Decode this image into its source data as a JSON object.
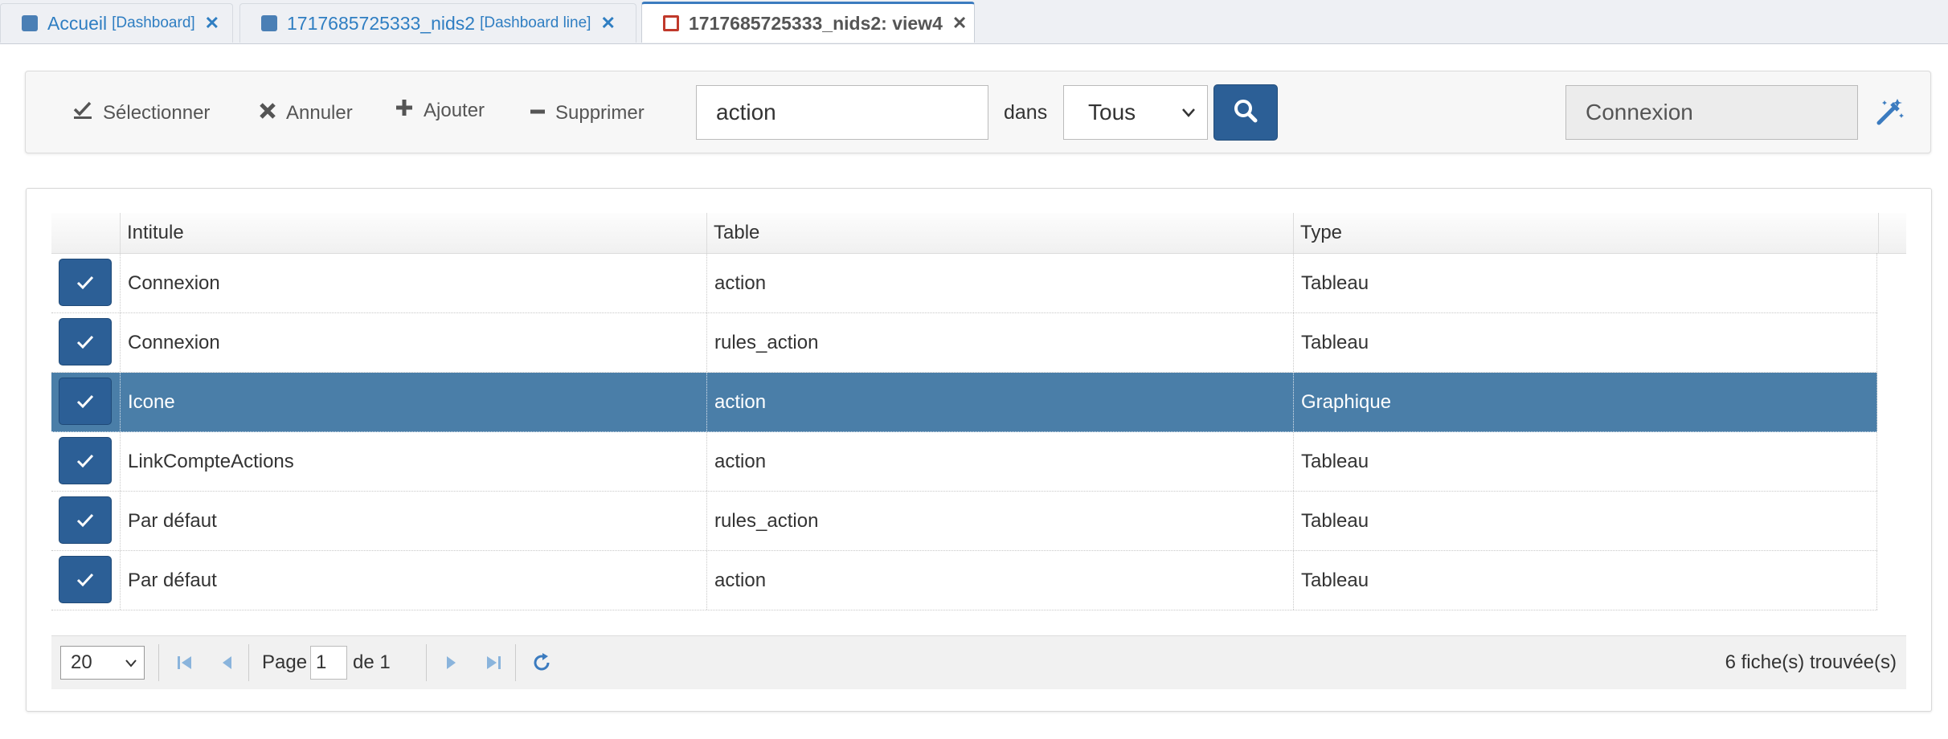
{
  "tabs": [
    {
      "label": "Accueil",
      "sub": "[Dashboard]",
      "active": false
    },
    {
      "label": "1717685725333_nids2",
      "sub": "[Dashboard line]",
      "active": false
    },
    {
      "label": "1717685725333_nids2: view4",
      "sub": "",
      "active": true
    }
  ],
  "toolbar": {
    "select_label": "Sélectionner",
    "cancel_label": "Annuler",
    "add_label": "Ajouter",
    "delete_label": "Supprimer",
    "search_value": "action",
    "in_label": "dans",
    "scope_value": "Tous",
    "connexion_value": "Connexion"
  },
  "table": {
    "headers": [
      "Intitule",
      "Table",
      "Type"
    ],
    "rows": [
      {
        "intitule": "Connexion",
        "table": "action",
        "type": "Tableau",
        "selected": false
      },
      {
        "intitule": "Connexion",
        "table": "rules_action",
        "type": "Tableau",
        "selected": false
      },
      {
        "intitule": "Icone",
        "table": "action",
        "type": "Graphique",
        "selected": true
      },
      {
        "intitule": "LinkCompteActions",
        "table": "action",
        "type": "Tableau",
        "selected": false
      },
      {
        "intitule": "Par défaut",
        "table": "rules_action",
        "type": "Tableau",
        "selected": false
      },
      {
        "intitule": "Par défaut",
        "table": "action",
        "type": "Tableau",
        "selected": false
      }
    ]
  },
  "pager": {
    "page_size": "20",
    "page_label": "Page",
    "page_value": "1",
    "of_label": "de 1",
    "found_label": "6 fiche(s) trouvée(s)"
  },
  "colors": {
    "accent": "#2c5f96",
    "selected_row": "#4a7ea8",
    "link": "#2f7ec2"
  }
}
